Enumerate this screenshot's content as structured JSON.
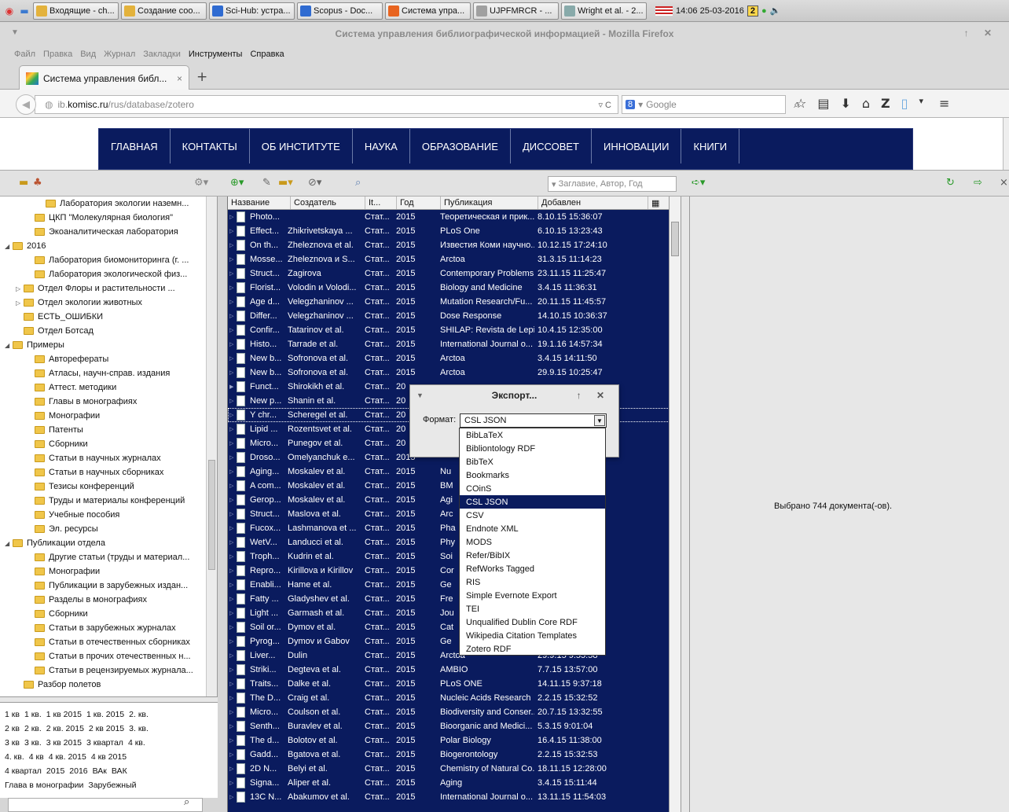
{
  "taskbar": {
    "tasks": [
      {
        "label": "Входящие - ch...",
        "color": "#e3b23c"
      },
      {
        "label": "Создание соо...",
        "color": "#e3b23c"
      },
      {
        "label": "Sci-Hub: устра...",
        "color": "#2f6bd1"
      },
      {
        "label": "Scopus - Doc...",
        "color": "#2f6bd1"
      },
      {
        "label": "Система упра...",
        "color": "#e86420"
      },
      {
        "label": "UJPFMRCR - ...",
        "color": "#a0a0a0"
      },
      {
        "label": "Wright et al. - 2...",
        "color": "#8aa"
      }
    ],
    "clock": "14:06 25-03-2016",
    "workspace": "2"
  },
  "window": {
    "title": "Система управления библиографической информацией - Mozilla Firefox"
  },
  "menu": [
    "Файл",
    "Правка",
    "Вид",
    "Журнал",
    "Закладки",
    "Инструменты",
    "Справка"
  ],
  "tab": {
    "title": "Система управления библ...",
    "close": "×",
    "new_tab": "+"
  },
  "nav": {
    "url_prefix": "ib.",
    "url_domain": "komisc.ru",
    "url_path": "/rus/database/zotero",
    "search_engine": "8",
    "search_placeholder": "Google"
  },
  "site_nav": [
    "Главная",
    "Контакты",
    "Об институте",
    "Наука",
    "Образование",
    "Диссовет",
    "Инновации",
    "Книги"
  ],
  "zotero": {
    "search_placeholder": "Заглавие, Автор, Год"
  },
  "collections": [
    {
      "label": "Лаборатория экологии наземн...",
      "indent": 3,
      "twisty": ""
    },
    {
      "label": "ЦКП \"Молекулярная биология\"",
      "indent": 2,
      "twisty": ""
    },
    {
      "label": "Экоаналитическая лаборатория",
      "indent": 2,
      "twisty": ""
    },
    {
      "label": "2016",
      "indent": 0,
      "twisty": "◢"
    },
    {
      "label": "Лаборатория биомониторинга (г. ...",
      "indent": 2,
      "twisty": ""
    },
    {
      "label": "Лаборатория экологической физ...",
      "indent": 2,
      "twisty": ""
    },
    {
      "label": "Отдел Флоры и растительности ...",
      "indent": 1,
      "twisty": "▷"
    },
    {
      "label": "Отдел экологии животных",
      "indent": 1,
      "twisty": "▷"
    },
    {
      "label": "ЕСТЬ_ОШИБКИ",
      "indent": 1,
      "twisty": ""
    },
    {
      "label": "Отдел Ботсад",
      "indent": 1,
      "twisty": ""
    },
    {
      "label": "Примеры",
      "indent": 0,
      "twisty": "◢"
    },
    {
      "label": "Авторефераты",
      "indent": 2,
      "twisty": ""
    },
    {
      "label": "Атласы, научн-справ. издания",
      "indent": 2,
      "twisty": ""
    },
    {
      "label": "Аттест. методики",
      "indent": 2,
      "twisty": ""
    },
    {
      "label": "Главы в монографиях",
      "indent": 2,
      "twisty": ""
    },
    {
      "label": "Монографии",
      "indent": 2,
      "twisty": ""
    },
    {
      "label": "Патенты",
      "indent": 2,
      "twisty": ""
    },
    {
      "label": "Сборники",
      "indent": 2,
      "twisty": ""
    },
    {
      "label": "Статьи в научных журналах",
      "indent": 2,
      "twisty": ""
    },
    {
      "label": "Статьи в научных сборниках",
      "indent": 2,
      "twisty": ""
    },
    {
      "label": "Тезисы конференций",
      "indent": 2,
      "twisty": ""
    },
    {
      "label": "Труды и материалы конференций",
      "indent": 2,
      "twisty": ""
    },
    {
      "label": "Учебные пособия",
      "indent": 2,
      "twisty": ""
    },
    {
      "label": "Эл. ресурсы",
      "indent": 2,
      "twisty": ""
    },
    {
      "label": "Публикации отдела",
      "indent": 0,
      "twisty": "◢"
    },
    {
      "label": "Другие статьи (труды и материал...",
      "indent": 2,
      "twisty": ""
    },
    {
      "label": "Монографии",
      "indent": 2,
      "twisty": ""
    },
    {
      "label": "Публикации в зарубежных издан...",
      "indent": 2,
      "twisty": ""
    },
    {
      "label": "Разделы в монографиях",
      "indent": 2,
      "twisty": ""
    },
    {
      "label": "Сборники",
      "indent": 2,
      "twisty": ""
    },
    {
      "label": "Статьи в зарубежных журналах",
      "indent": 2,
      "twisty": ""
    },
    {
      "label": "Статьи в отечественных сборниках",
      "indent": 2,
      "twisty": ""
    },
    {
      "label": "Статьи в прочих отечественных н...",
      "indent": 2,
      "twisty": ""
    },
    {
      "label": "Статьи в рецензируемых журнала...",
      "indent": 2,
      "twisty": ""
    },
    {
      "label": "Разбор полетов",
      "indent": 1,
      "twisty": ""
    }
  ],
  "tags": [
    [
      "1 кв",
      "1 кв.",
      "1 кв 2015",
      "1 кв. 2015",
      "2. кв."
    ],
    [
      "2 кв",
      "2 кв.",
      "2 кв. 2015",
      "2 кв 2015",
      "3. кв."
    ],
    [
      "3 кв",
      "3 кв.",
      "3 кв 2015",
      "3 квартал",
      "4 кв."
    ],
    [
      "4. кв.",
      "4 кв",
      "4 кв. 2015",
      "4 кв 2015"
    ],
    [
      "4 квартал",
      "2015",
      "2016",
      "ВАк",
      "ВАК"
    ],
    [
      "Глава в монографии",
      "Зарубежный"
    ]
  ],
  "items_columns": [
    "Название",
    "Создатель",
    "It...",
    "Год",
    "Публикация",
    "Добавлен"
  ],
  "items": [
    {
      "title": "Photo...",
      "creator": "",
      "type": "Стат...",
      "year": "2015",
      "pub": "Теоретическая и прик...",
      "added": "8.10.15 15:36:07"
    },
    {
      "title": "Effect...",
      "creator": "Zhikrivetskaya ...",
      "type": "Стат...",
      "year": "2015",
      "pub": "PLoS One",
      "added": "6.10.15 13:23:43"
    },
    {
      "title": "On th...",
      "creator": "Zheleznova et al.",
      "type": "Стат...",
      "year": "2015",
      "pub": "Известия Коми научно...",
      "added": "10.12.15 17:24:10"
    },
    {
      "title": "Mosse...",
      "creator": "Zheleznova и S...",
      "type": "Стат...",
      "year": "2015",
      "pub": "Arctoa",
      "added": "31.3.15 11:14:23"
    },
    {
      "title": "Struct...",
      "creator": "Zagirova",
      "type": "Стат...",
      "year": "2015",
      "pub": "Contemporary Problems ...",
      "added": "23.11.15 11:25:47"
    },
    {
      "title": "Florist...",
      "creator": "Volodin и Volodi...",
      "type": "Стат...",
      "year": "2015",
      "pub": "Biology and Medicine",
      "added": "3.4.15 11:36:31"
    },
    {
      "title": "Age d...",
      "creator": "Velegzhaninov ...",
      "type": "Стат...",
      "year": "2015",
      "pub": "Mutation Research/Fu...",
      "added": "20.11.15 11:45:57"
    },
    {
      "title": "Differ...",
      "creator": "Velegzhaninov ...",
      "type": "Стат...",
      "year": "2015",
      "pub": "Dose Response",
      "added": "14.10.15 10:36:37"
    },
    {
      "title": "Confir...",
      "creator": "Tatarinov et al.",
      "type": "Стат...",
      "year": "2015",
      "pub": "SHILAP: Revista de Lepi...",
      "added": "10.4.15 12:35:00"
    },
    {
      "title": "Histo...",
      "creator": "Tarrade et al.",
      "type": "Стат...",
      "year": "2015",
      "pub": "International Journal o...",
      "added": "19.1.16 14:57:34"
    },
    {
      "title": "New b...",
      "creator": "Sofronova et al.",
      "type": "Стат...",
      "year": "2015",
      "pub": "Arctoa",
      "added": "3.4.15 14:11:50"
    },
    {
      "title": "New b...",
      "creator": "Sofronova et al.",
      "type": "Стат...",
      "year": "2015",
      "pub": "Arctoa",
      "added": "29.9.15 10:25:47"
    },
    {
      "title": "Funct...",
      "creator": "Shirokikh et al.",
      "type": "Стат...",
      "year": "20",
      "pub": "",
      "added": ""
    },
    {
      "title": "New p...",
      "creator": "Shanin et al.",
      "type": "Стат...",
      "year": "20",
      "pub": "",
      "added": ""
    },
    {
      "title": "Y chr...",
      "creator": "Scheregel et al.",
      "type": "Стат...",
      "year": "20",
      "pub": "",
      "added": ":2"
    },
    {
      "title": "Lipid ...",
      "creator": "Rozentsvet et al.",
      "type": "Стат...",
      "year": "20",
      "pub": "",
      "added": ""
    },
    {
      "title": "Micro...",
      "creator": "Punegov et al.",
      "type": "Стат...",
      "year": "20",
      "pub": "",
      "added": ":3"
    },
    {
      "title": "Droso...",
      "creator": "Omelyanchuk e...",
      "type": "Стат...",
      "year": "2015",
      "pub": "",
      "added": ":26"
    },
    {
      "title": "Aging...",
      "creator": "Moskalev et al.",
      "type": "Стат...",
      "year": "2015",
      "pub": "Nu",
      "added": ":00"
    },
    {
      "title": "A com...",
      "creator": "Moskalev et al.",
      "type": "Стат...",
      "year": "2015",
      "pub": "BM",
      "added": ":24"
    },
    {
      "title": "Gerop...",
      "creator": "Moskalev et al.",
      "type": "Стат...",
      "year": "2015",
      "pub": "Agi",
      "added": ":14"
    },
    {
      "title": "Struct...",
      "creator": "Maslova et al.",
      "type": "Стат...",
      "year": "2015",
      "pub": "Arc",
      "added": ":08"
    },
    {
      "title": "Fucox...",
      "creator": "Lashmanova et ...",
      "type": "Стат...",
      "year": "2015",
      "pub": "Pha",
      "added": ":00"
    },
    {
      "title": "WetV...",
      "creator": "Landucci et al.",
      "type": "Стат...",
      "year": "2015",
      "pub": "Phy",
      "added": "5:35"
    },
    {
      "title": "Troph...",
      "creator": "Kudrin et al.",
      "type": "Стат...",
      "year": "2015",
      "pub": "Soi",
      "added": "43"
    },
    {
      "title": "Repro...",
      "creator": "Kirillova и Kirillov",
      "type": "Стат...",
      "year": "2015",
      "pub": "Cor",
      "added": "53"
    },
    {
      "title": "Enabli...",
      "creator": "Hame et al.",
      "type": "Стат...",
      "year": "2015",
      "pub": "Ge",
      "added": "9"
    },
    {
      "title": "Fatty ...",
      "creator": "Gladyshev et al.",
      "type": "Стат...",
      "year": "2015",
      "pub": "Fre",
      "added": ":34"
    },
    {
      "title": "Light ...",
      "creator": "Garmash et al.",
      "type": "Стат...",
      "year": "2015",
      "pub": "Jou",
      "added": ":36"
    },
    {
      "title": "Soil or...",
      "creator": "Dymov et al.",
      "type": "Стат...",
      "year": "2015",
      "pub": "Cat",
      "added": ":35"
    },
    {
      "title": "Pyrog...",
      "creator": "Dymov и Gabov",
      "type": "Стат...",
      "year": "2015",
      "pub": "Ge",
      "added": ":40"
    },
    {
      "title": "Liver...",
      "creator": "Dulin",
      "type": "Стат...",
      "year": "2015",
      "pub": "Arctoa",
      "added": "29.9.15 9:55:58"
    },
    {
      "title": "Striki...",
      "creator": "Degteva et al.",
      "type": "Стат...",
      "year": "2015",
      "pub": "AMBIO",
      "added": "7.7.15 13:57:00"
    },
    {
      "title": "Traits...",
      "creator": "Dalke et al.",
      "type": "Стат...",
      "year": "2015",
      "pub": "PLoS ONE",
      "added": "14.11.15 9:37:18"
    },
    {
      "title": "The D...",
      "creator": "Craig et al.",
      "type": "Стат...",
      "year": "2015",
      "pub": "Nucleic Acids Research",
      "added": "2.2.15 15:32:52"
    },
    {
      "title": "Micro...",
      "creator": "Coulson et al.",
      "type": "Стат...",
      "year": "2015",
      "pub": "Biodiversity and Conser...",
      "added": "20.7.15 13:32:55"
    },
    {
      "title": "Senth...",
      "creator": "Buravlev et al.",
      "type": "Стат...",
      "year": "2015",
      "pub": "Bioorganic and Medici...",
      "added": "5.3.15 9:01:04"
    },
    {
      "title": "The d...",
      "creator": "Bolotov et al.",
      "type": "Стат...",
      "year": "2015",
      "pub": "Polar Biology",
      "added": "16.4.15 11:38:00"
    },
    {
      "title": "Gadd...",
      "creator": "Bgatova et al.",
      "type": "Стат...",
      "year": "2015",
      "pub": "Biogerontology",
      "added": "2.2.15 15:32:53"
    },
    {
      "title": "2D N...",
      "creator": "Belyi et al.",
      "type": "Стат...",
      "year": "2015",
      "pub": "Chemistry of Natural Co...",
      "added": "18.11.15 12:28:00"
    },
    {
      "title": "Signa...",
      "creator": "Aliper et al.",
      "type": "Стат...",
      "year": "2015",
      "pub": "Aging",
      "added": "3.4.15 15:11:44"
    },
    {
      "title": "13C N...",
      "creator": "Abakumov et al.",
      "type": "Стат...",
      "year": "2015",
      "pub": "International Journal o...",
      "added": "13.11.15 11:54:03"
    }
  ],
  "right_pane": {
    "selected_msg": "Выбрано 744 документа(-ов)."
  },
  "export": {
    "title": "Экспорт...",
    "format_label": "Формат:",
    "selected": "CSL JSON",
    "options": [
      "BibLaTeX",
      "Bibliontology RDF",
      "BibTeX",
      "Bookmarks",
      "COinS",
      "CSL JSON",
      "CSV",
      "Endnote XML",
      "MODS",
      "Refer/BibIX",
      "RefWorks Tagged",
      "RIS",
      "Simple Evernote Export",
      "TEI",
      "Unqualified Dublin Core RDF",
      "Wikipedia Citation Templates",
      "Zotero RDF"
    ]
  },
  "colors": {
    "items_bg": "#0a1b5e",
    "site_nav_bg": "#0a1b5e"
  }
}
